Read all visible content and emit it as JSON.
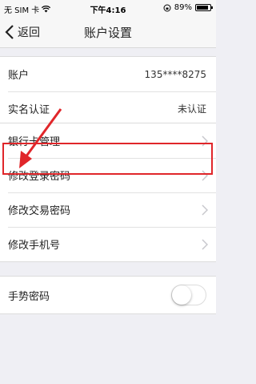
{
  "status_bar": {
    "carrier": "无 SIM 卡",
    "time": "下午4:16",
    "battery_percent": "89%",
    "battery_level": 0.89
  },
  "nav": {
    "back_label": "返回",
    "title": "账户设置"
  },
  "account_group": {
    "account_label": "账户",
    "account_value": "135****8275",
    "realname_label": "实名认证",
    "realname_value": "未认证"
  },
  "settings_group": {
    "bank_card": "银行卡管理",
    "login_password": "修改登录密码",
    "trade_password": "修改交易密码",
    "phone": "修改手机号"
  },
  "gesture_group": {
    "gesture_label": "手势密码",
    "gesture_enabled": false
  },
  "colors": {
    "highlight": "#e0262a",
    "background": "#efeff4"
  }
}
